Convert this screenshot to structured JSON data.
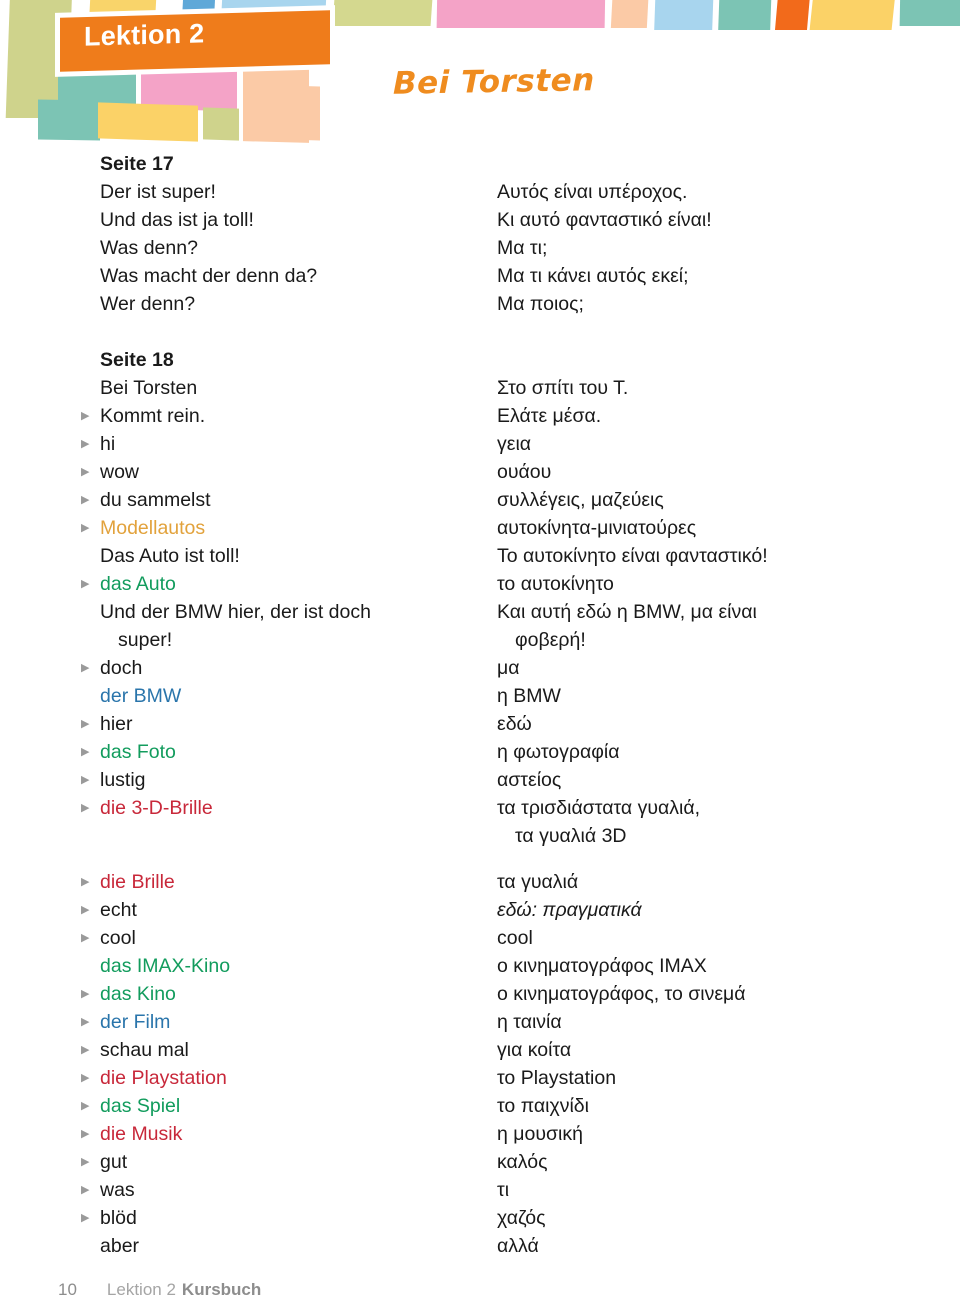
{
  "header": {
    "banner_label": "Lektion 2",
    "chapter_title": "Bei Torsten",
    "banner_color": "#ef7c1b",
    "title_color": "#ef8c1f",
    "tiles": [
      {
        "name": "tile-yellow-top-1",
        "color": "#f9d46a"
      },
      {
        "name": "tile-blue-top-1",
        "color": "#5fa8d8"
      },
      {
        "name": "tile-lightblue-top",
        "color": "#a8d5ee"
      },
      {
        "name": "tile-olive-left",
        "color": "#cfd38c"
      },
      {
        "name": "tile-olive-top",
        "color": "#d4d88f"
      },
      {
        "name": "tile-pink-top",
        "color": "#f4a3c7"
      },
      {
        "name": "tile-peach-top",
        "color": "#fbcaa6"
      },
      {
        "name": "tile-lightblue-2",
        "color": "#a8d5ee"
      },
      {
        "name": "tile-teal-top",
        "color": "#7cc4b4"
      },
      {
        "name": "tile-orange-top",
        "color": "#f26a1b"
      },
      {
        "name": "tile-yellow-top-2",
        "color": "#fbd267"
      },
      {
        "name": "tile-teal-right",
        "color": "#7cc4b4"
      },
      {
        "name": "tile-teal-big",
        "color": "#7cc4b4"
      },
      {
        "name": "tile-pink-mid",
        "color": "#f4a3c7"
      },
      {
        "name": "tile-peach-mid",
        "color": "#fbcaa6"
      },
      {
        "name": "tile-yellow-mid",
        "color": "#fbd267"
      },
      {
        "name": "tile-olive-small",
        "color": "#cfd38c"
      }
    ]
  },
  "colors": {
    "neuter_das": "#129c5d",
    "masculine_der": "#2a75ab",
    "feminine_die": "#c8283a",
    "plural": "#e2a23c",
    "bullet": "#9a9a9a"
  },
  "rows": [
    {
      "type": "head",
      "de": "Seite 17",
      "el": ""
    },
    {
      "type": "plain",
      "de": "Der ist super!",
      "el": "Αυτός είναι υπέροχος."
    },
    {
      "type": "plain",
      "de": "Und das ist ja toll!",
      "el": "Κι αυτό φανταστικό είναι!"
    },
    {
      "type": "plain",
      "de": "Was denn?",
      "el": "Μα τι;"
    },
    {
      "type": "plain",
      "de": "Was macht der denn da?",
      "el": "Μα τι κάνει αυτός εκεί;"
    },
    {
      "type": "plain",
      "de": "Wer denn?",
      "el": "Μα ποιος;"
    },
    {
      "type": "spacer",
      "de": "",
      "el": ""
    },
    {
      "type": "head",
      "de": "Seite 18",
      "el": ""
    },
    {
      "type": "plain",
      "de": "Bei Torsten",
      "el": "Στο σπίτι του Τ."
    },
    {
      "type": "bullet",
      "de": "Kommt rein.",
      "el": "Ελάτε μέσα."
    },
    {
      "type": "bullet",
      "de": "hi",
      "el": "γεια"
    },
    {
      "type": "bullet",
      "de": "wow",
      "el": "ουάου"
    },
    {
      "type": "bullet",
      "de": "du sammelst",
      "el": "συλλέγεις, μαζεύεις"
    },
    {
      "type": "bullet",
      "de": "Modellautos",
      "de_class": "c-plur",
      "el": "αυτοκίνητα-μινιατούρες"
    },
    {
      "type": "plain",
      "de": "Das Auto ist toll!",
      "el": "Το αυτοκίνητο είναι φανταστικό!"
    },
    {
      "type": "bullet",
      "de": "das Auto",
      "de_class": "c-neut",
      "el": "το αυτοκίνητο"
    },
    {
      "type": "plain",
      "de": "Und der BMW hier, der ist doch",
      "el": "Και αυτή εδώ η BMW, μα είναι"
    },
    {
      "type": "indent",
      "de": "super!",
      "el": "φοβερή!"
    },
    {
      "type": "bullet",
      "de": "doch",
      "el": "μα"
    },
    {
      "type": "plain",
      "de": "der BMW",
      "de_class": "c-masc",
      "el": "η BMW"
    },
    {
      "type": "bullet",
      "de": "hier",
      "el": "εδώ"
    },
    {
      "type": "bullet",
      "de": "das Foto",
      "de_class": "c-neut",
      "el": "η φωτογραφία"
    },
    {
      "type": "bullet",
      "de": "lustig",
      "el": "αστείος"
    },
    {
      "type": "bullet",
      "de": "die 3-D-Brille",
      "de_class": "c-fem",
      "el": "τα τρισδιάστατα γυαλιά,"
    },
    {
      "type": "indent",
      "de": "",
      "el": "τα γυαλιά 3D"
    },
    {
      "type": "gap14",
      "de": "",
      "el": ""
    },
    {
      "type": "bullet",
      "de": "die Brille",
      "de_class": "c-fem",
      "el": "τα γυαλιά"
    },
    {
      "type": "bullet",
      "de": "echt",
      "el": "εδώ: πραγματικά",
      "el_class": "ital"
    },
    {
      "type": "bullet",
      "de": "cool",
      "el": "cool"
    },
    {
      "type": "plain",
      "de": "das IMAX-Kino",
      "de_class": "c-neut",
      "el": "ο κινηματογράφος IMAX"
    },
    {
      "type": "bullet",
      "de": "das Kino",
      "de_class": "c-neut",
      "el": "ο κινηματογράφος, το σινεμά"
    },
    {
      "type": "bullet",
      "de": "der Film",
      "de_class": "c-masc",
      "el": "η ταινία"
    },
    {
      "type": "bullet",
      "de": "schau mal",
      "el": "για κοίτα"
    },
    {
      "type": "bullet",
      "de": "die Playstation",
      "de_class": "c-fem",
      "el": "το Playstation"
    },
    {
      "type": "bullet",
      "de": "das Spiel",
      "de_class": "c-neut",
      "el": "το παιχνίδι"
    },
    {
      "type": "bullet",
      "de": "die Musik",
      "de_class": "c-fem",
      "el": "η μουσική"
    },
    {
      "type": "bullet",
      "de": "gut",
      "el": "καλός"
    },
    {
      "type": "bullet",
      "de": "was",
      "el": "τι"
    },
    {
      "type": "bullet",
      "de": "blöd",
      "el": "χαζός"
    },
    {
      "type": "plain",
      "de": "aber",
      "el": "αλλά"
    }
  ],
  "footer": {
    "page_number": "10",
    "lesson": "Lektion 2",
    "book": "Kursbuch"
  },
  "icons": {
    "bullet_arrow": "▶"
  }
}
